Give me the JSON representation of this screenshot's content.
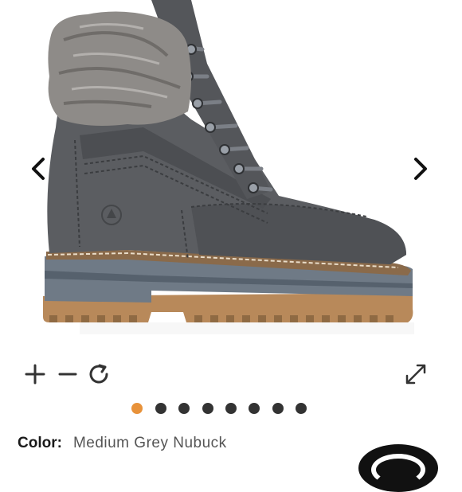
{
  "product": {
    "image_alt": "Grey nubuck lace-up boot with faux fur cuff",
    "color_label": "Color:",
    "color_value": "Medium Grey Nubuck"
  },
  "gallery": {
    "total_images": 8,
    "active_index": 0,
    "active_color": "#e8923a",
    "inactive_color": "#333333"
  },
  "icons": {
    "prev": "chevron-left-icon",
    "next": "chevron-right-icon",
    "zoom_in": "plus-icon",
    "zoom_out": "minus-icon",
    "reset": "rotate-icon",
    "fullscreen": "expand-icon"
  }
}
